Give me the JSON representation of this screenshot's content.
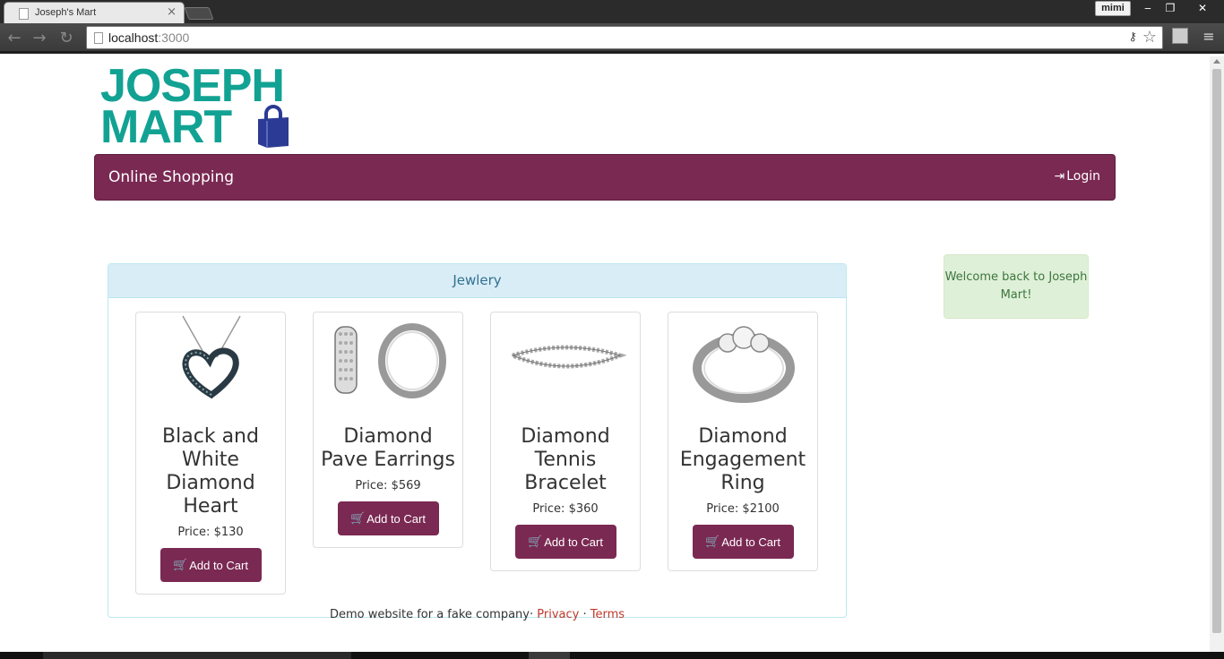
{
  "browser": {
    "tab_title": "Joseph's Mart",
    "tab_close": "×",
    "profile": "mimi",
    "window_buttons": {
      "minimize": "‒",
      "maximize": "❐",
      "close": "✕"
    },
    "url_host": "localhost",
    "url_port": ":3000"
  },
  "logo": {
    "line1": "JOSEPH",
    "line2": "MART"
  },
  "navbar": {
    "brand": "Online Shopping",
    "login": "Login"
  },
  "panel": {
    "heading": "Jewlery"
  },
  "products": [
    {
      "name": "Black and White Diamond Heart",
      "price": "Price: $130",
      "button": "Add to Cart"
    },
    {
      "name": "Diamond Pave Earrings",
      "price": "Price: $569",
      "button": "Add to Cart"
    },
    {
      "name": "Diamond Tennis Bracelet",
      "price": "Price: $360",
      "button": "Add to Cart"
    },
    {
      "name": "Diamond Engagement Ring",
      "price": "Price: $2100",
      "button": "Add to Cart"
    }
  ],
  "alert": {
    "message": "Welcome back to Joseph Mart!"
  },
  "footer": {
    "text": "Demo website for a fake company·",
    "privacy": "Privacy",
    "sep": " · ",
    "terms": "Terms"
  },
  "colors": {
    "brand": "#7a2952",
    "logo": "#12a293",
    "bag": "#2b3a93"
  }
}
